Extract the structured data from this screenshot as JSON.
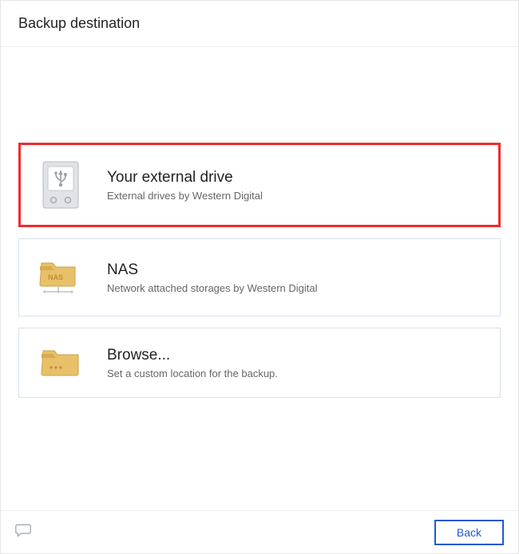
{
  "header": {
    "title": "Backup destination"
  },
  "options": {
    "externalDrive": {
      "title": "Your external drive",
      "description": "External drives by Western Digital"
    },
    "nas": {
      "title": "NAS",
      "description": "Network attached storages by Western Digital"
    },
    "browse": {
      "title": "Browse...",
      "description": "Set a custom location for the backup."
    }
  },
  "footer": {
    "backLabel": "Back"
  }
}
